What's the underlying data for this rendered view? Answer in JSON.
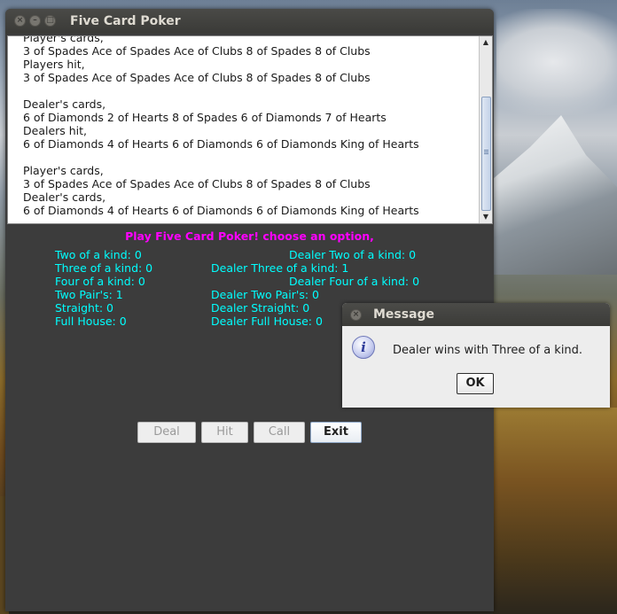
{
  "window": {
    "title": "Five Card Poker",
    "close_glyph": "×",
    "min_glyph": "–",
    "max_glyph": "□"
  },
  "log_lines": [
    "Player's cards,",
    "3 of Spades Ace of Spades Ace of Clubs 8 of Spades 8 of Clubs",
    "Players hit,",
    "3 of Spades Ace of Spades Ace of Clubs 8 of Spades 8 of Clubs",
    "",
    "Dealer's cards,",
    "6 of Diamonds 2 of Hearts 8 of Spades 6 of Diamonds 7 of Hearts",
    "Dealers hit,",
    "6 of Diamonds 4 of Hearts 6 of Diamonds 6 of Diamonds King of Hearts",
    "",
    "Player's cards,",
    "3 of Spades Ace of Spades Ace of Clubs 8 of Spades 8 of Clubs",
    "Dealer's cards,",
    "6 of Diamonds 4 of Hearts 6 of Diamonds 6 of Diamonds King of Hearts"
  ],
  "prompt": "Play Five Card Poker! choose an option,",
  "stats": {
    "player_two_kind": "Two of a kind: 0",
    "dealer_two_kind": "Dealer Two of a kind: 0",
    "player_three_kind": "Three of a kind: 0",
    "dealer_three_kind": "Dealer Three of a kind: 1",
    "player_four_kind": "Four of a kind: 0",
    "dealer_four_kind": "Dealer Four of a kind: 0",
    "player_two_pair": "Two Pair's: 1",
    "dealer_two_pair": "Dealer Two Pair's: 0",
    "player_straight": "Straight: 0",
    "dealer_straight": "Dealer Straight: 0",
    "player_full_house": "Full House: 0",
    "dealer_full_house": "Dealer Full House: 0"
  },
  "buttons": {
    "deal": "Deal",
    "hit": "Hit",
    "call": "Call",
    "exit": "Exit"
  },
  "dialog": {
    "title": "Message",
    "icon_glyph": "i",
    "message": "Dealer wins with Three of a kind.",
    "ok": "OK"
  },
  "colors": {
    "prompt": "#ff00ff",
    "stats": "#00ffff",
    "window_bg": "#3c3c3c"
  }
}
